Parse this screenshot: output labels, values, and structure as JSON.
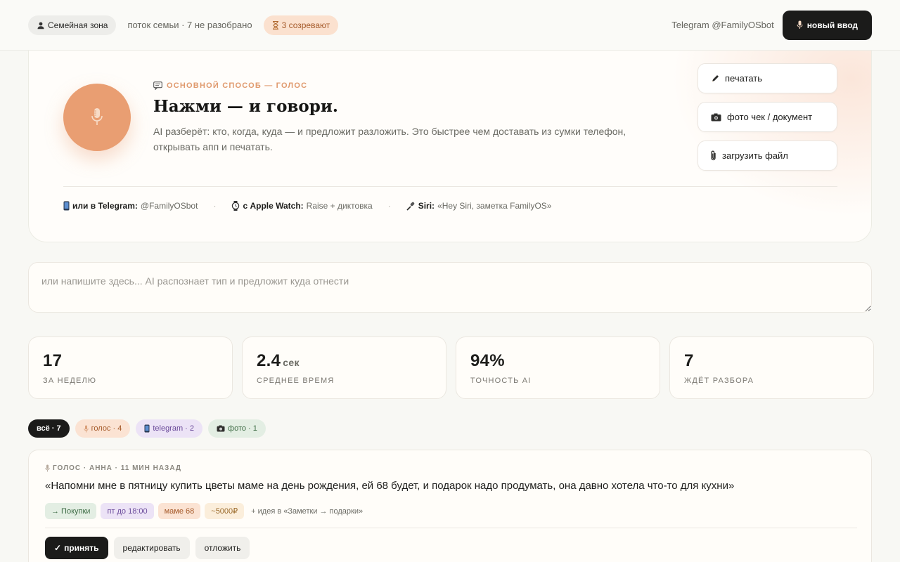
{
  "topbar": {
    "zone_label": "Семейная зона",
    "stream_text": "поток семьи · 7 не разобрано",
    "ripen_label": "3 созревают",
    "telegram_text": "Telegram @FamilyOSbot",
    "new_input_label": "новый ввод"
  },
  "hero": {
    "label": "ОСНОВНОЙ СПОСОБ — ГОЛОС",
    "title": "Нажми — и говори.",
    "description": "AI разберёт: кто, когда, куда — и предложит разложить. Это быстрее чем доставать из сумки телефон, открывать апп и печатать.",
    "actions": [
      {
        "label": "печатать",
        "icon": "pencil-icon"
      },
      {
        "label": "фото чек / документ",
        "icon": "camera-icon"
      },
      {
        "label": "загрузить файл",
        "icon": "paperclip-icon"
      }
    ],
    "alternatives": [
      {
        "title": "или в Telegram:",
        "detail": "@FamilyOSbot",
        "icon": "phone-icon"
      },
      {
        "title": "с Apple Watch:",
        "detail": "Raise + диктовка",
        "icon": "watch-icon"
      },
      {
        "title": "Siri:",
        "detail": "«Hey Siri, заметка FamilyOS»",
        "icon": "microphone-icon"
      }
    ]
  },
  "note_input": {
    "placeholder": "или напишите здесь... AI распознает тип и предложит куда отнести"
  },
  "stats": [
    {
      "value": "17",
      "unit": "",
      "label": "ЗА НЕДЕЛЮ"
    },
    {
      "value": "2.4",
      "unit": "сек",
      "label": "СРЕДНЕЕ ВРЕМЯ"
    },
    {
      "value": "94%",
      "unit": "",
      "label": "ТОЧНОСТЬ AI"
    },
    {
      "value": "7",
      "unit": "",
      "label": "ЖДЁТ РАЗБОРА"
    }
  ],
  "filters": [
    {
      "label": "всё · 7"
    },
    {
      "label": "голос · 4"
    },
    {
      "label": "telegram · 2"
    },
    {
      "label": "фото · 1"
    }
  ],
  "card": {
    "meta": "ГОЛОС · АННА · 11 МИН НАЗАД",
    "text": "«Напомни мне в пятницу купить цветы маме на день рождения, ей 68 будет, и подарок надо продумать, она давно хотела что-то для кухни»",
    "tags": {
      "category": "→ Покупки",
      "time": "пт до 18:00",
      "person": "маме 68",
      "money": "~5000₽",
      "idea": "+ идея в «Заметки → подарки»"
    },
    "actions": {
      "accept": "принять",
      "edit": "редактировать",
      "postpone": "отложить"
    }
  },
  "colors": {
    "accent": "#e99e72",
    "dark": "#1b1b1a",
    "background": "#f8f8f4"
  }
}
